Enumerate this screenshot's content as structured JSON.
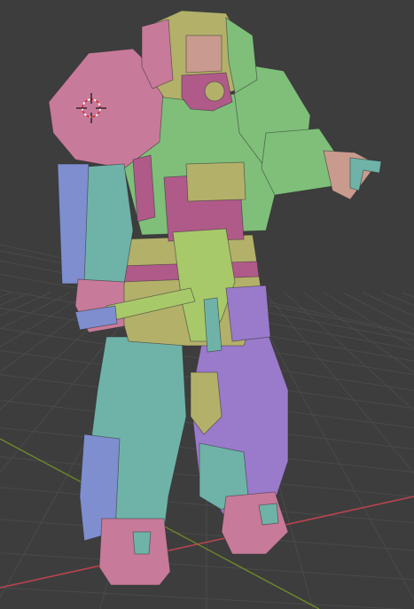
{
  "viewport": {
    "background_color": "#3d3d3d",
    "grid_line_color": "#4a4a4a",
    "x_axis_color": "#b8434f",
    "y_axis_color": "#6e8a2a",
    "cursor_icon": "3d-cursor-icon"
  },
  "model": {
    "palette": {
      "pink": "#c87a9a",
      "mauve": "#b05a8a",
      "green": "#7fbf7a",
      "teal": "#6fb3a8",
      "olive": "#b3b06a",
      "purple": "#9a7acb",
      "blue": "#7e8ecf",
      "lime": "#a8c96a",
      "skin": "#c99b8e"
    }
  }
}
